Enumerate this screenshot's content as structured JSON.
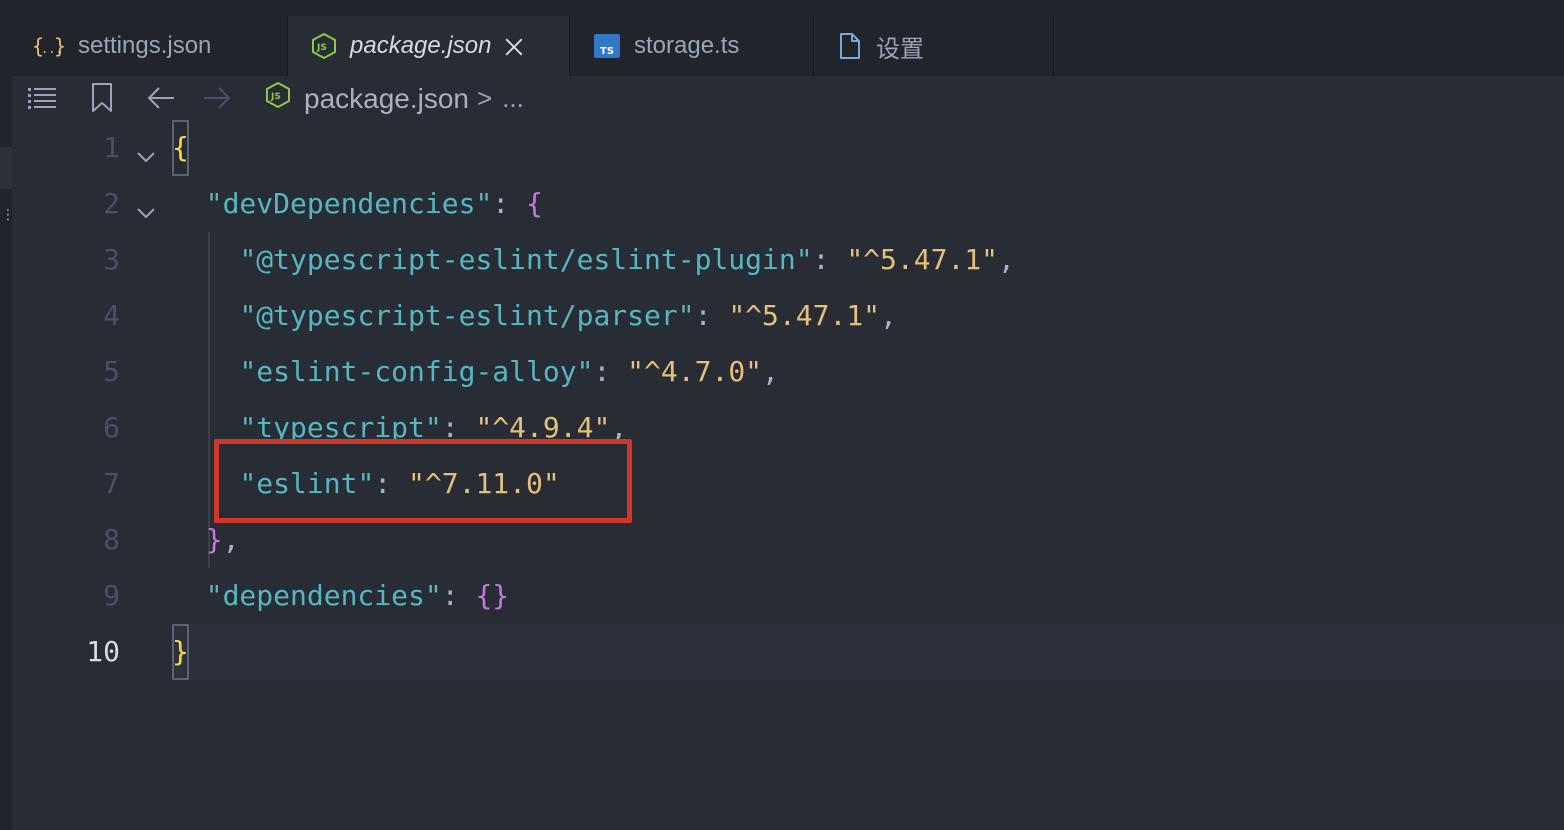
{
  "tabs": [
    {
      "label": "settings.json",
      "icon": "json-braces-icon",
      "active": false
    },
    {
      "label": "package.json",
      "icon": "nodejs-icon",
      "active": true
    },
    {
      "label": "storage.ts",
      "icon": "typescript-icon",
      "active": false
    },
    {
      "label": "设置",
      "icon": "document-icon",
      "active": false
    }
  ],
  "breadcrumbs": {
    "file": "package.json",
    "separator": ">",
    "more": "..."
  },
  "editor": {
    "current_line": 10,
    "lines": [
      {
        "num": "1"
      },
      {
        "num": "2"
      },
      {
        "num": "3"
      },
      {
        "num": "4"
      },
      {
        "num": "5"
      },
      {
        "num": "6"
      },
      {
        "num": "7"
      },
      {
        "num": "8"
      },
      {
        "num": "9"
      },
      {
        "num": "10"
      }
    ],
    "tokens": {
      "l1_brace": "{",
      "l2_key": "\"devDependencies\"",
      "l2_colon": ": ",
      "l2_brace": "{",
      "l3_key": "\"@typescript-eslint/eslint-plugin\"",
      "l3_colon": ": ",
      "l3_val": "\"^5.47.1\"",
      "l3_comma": ",",
      "l4_key": "\"@typescript-eslint/parser\"",
      "l4_colon": ": ",
      "l4_val": "\"^5.47.1\"",
      "l4_comma": ",",
      "l5_key": "\"eslint-config-alloy\"",
      "l5_colon": ": ",
      "l5_val": "\"^4.7.0\"",
      "l5_comma": ",",
      "l6_key": "\"typescript\"",
      "l6_colon": ": ",
      "l6_val": "\"^4.9.4\"",
      "l6_comma": ",",
      "l7_key": "\"eslint\"",
      "l7_colon": ": ",
      "l7_val": "\"^7.11.0\"",
      "l8_brace": "}",
      "l8_comma": ",",
      "l9_key": "\"dependencies\"",
      "l9_colon": ": ",
      "l9_braces": "{}",
      "l10_brace": "}"
    }
  },
  "colors": {
    "key": "#56b6c2",
    "string": "#e5c07b",
    "bracket_level1": "#f9d949",
    "bracket_level2": "#c678dd",
    "highlight_box": "#d0362a"
  }
}
